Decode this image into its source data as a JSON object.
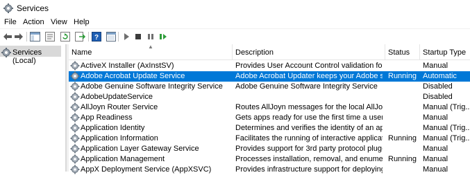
{
  "window": {
    "title": "Services"
  },
  "menu": [
    "File",
    "Action",
    "View",
    "Help"
  ],
  "toolbar_icons": [
    "back-arrow-icon",
    "forward-arrow-icon",
    "show-hide-console-tree-icon",
    "properties-icon",
    "refresh-icon",
    "export-list-icon",
    "help-icon",
    "console-icon",
    "start-service-icon",
    "stop-service-icon",
    "pause-service-icon",
    "restart-service-icon"
  ],
  "nav": {
    "selected_item": "Services (Local)"
  },
  "columns": {
    "name": "Name",
    "description": "Description",
    "status": "Status",
    "startup": "Startup Type"
  },
  "rows": [
    {
      "name": "ActiveX Installer (AxInstSV)",
      "description": "Provides User Account Control validation for the...",
      "status": "",
      "startup": "Manual"
    },
    {
      "name": "Adobe Acrobat Update Service",
      "description": "Adobe Acrobat Updater keeps your Adobe softw...",
      "status": "Running",
      "startup": "Automatic",
      "selected": true
    },
    {
      "name": "Adobe Genuine Software Integrity Service",
      "description": "Adobe Genuine Software Integrity Service",
      "status": "",
      "startup": "Disabled"
    },
    {
      "name": "AdobeUpdateService",
      "description": "",
      "status": "",
      "startup": "Disabled"
    },
    {
      "name": "AllJoyn Router Service",
      "description": "Routes AllJoyn messages for the local AllJoyn cli...",
      "status": "",
      "startup": "Manual (Trig..."
    },
    {
      "name": "App Readiness",
      "description": "Gets apps ready for use the first time a user signs...",
      "status": "",
      "startup": "Manual"
    },
    {
      "name": "Application Identity",
      "description": "Determines and verifies the identity of an applic...",
      "status": "",
      "startup": "Manual (Trig..."
    },
    {
      "name": "Application Information",
      "description": "Facilitates the running of interactive applications...",
      "status": "Running",
      "startup": "Manual (Trig..."
    },
    {
      "name": "Application Layer Gateway Service",
      "description": "Provides support for 3rd party protocol plug-ins ...",
      "status": "",
      "startup": "Manual"
    },
    {
      "name": "Application Management",
      "description": "Processes installation, removal, and enumeratio...",
      "status": "Running",
      "startup": "Manual"
    },
    {
      "name": "AppX Deployment Service (AppXSVC)",
      "description": "Provides infrastructure support for deploying St...",
      "status": "",
      "startup": "Manual"
    }
  ],
  "colors": {
    "selection": "#0078d7",
    "nav_selection": "#d9d9d9",
    "toolbar_green": "#2e9d3a",
    "toolbar_blue": "#1e5fb4"
  }
}
